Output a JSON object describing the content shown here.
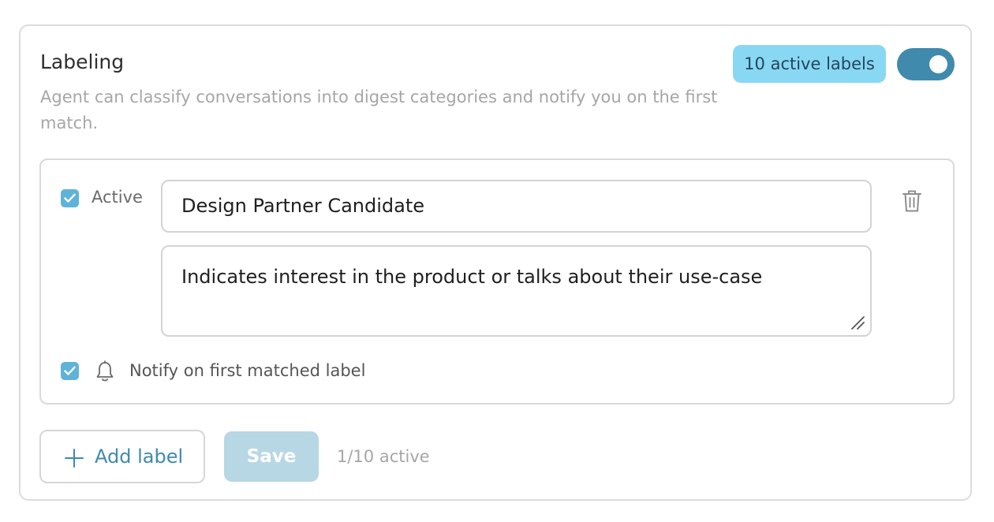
{
  "section": {
    "title": "Labeling",
    "description": "Agent can classify conversations into digest categories and notify you on the first match.",
    "badge": "10 active labels",
    "enabled": true
  },
  "label": {
    "active_label": "Active",
    "active_checked": true,
    "name_value": "Design Partner Candidate",
    "description_value": "Indicates interest in the product or talks about their use-case",
    "notify_label": "Notify on first matched label",
    "notify_checked": true
  },
  "footer": {
    "add_label": "Add label",
    "save_label": "Save",
    "active_count": "1/10 active"
  },
  "icons": {
    "delete": "trash-icon",
    "notify": "bell-icon",
    "add": "plus-icon",
    "check": "checkmark-icon",
    "resize": "resize-handle-icon"
  },
  "colors": {
    "accent": "#3f8aad",
    "badge_bg": "#88d8f4",
    "checkbox": "#5fb3d8",
    "save_disabled": "#b8d7e4"
  }
}
